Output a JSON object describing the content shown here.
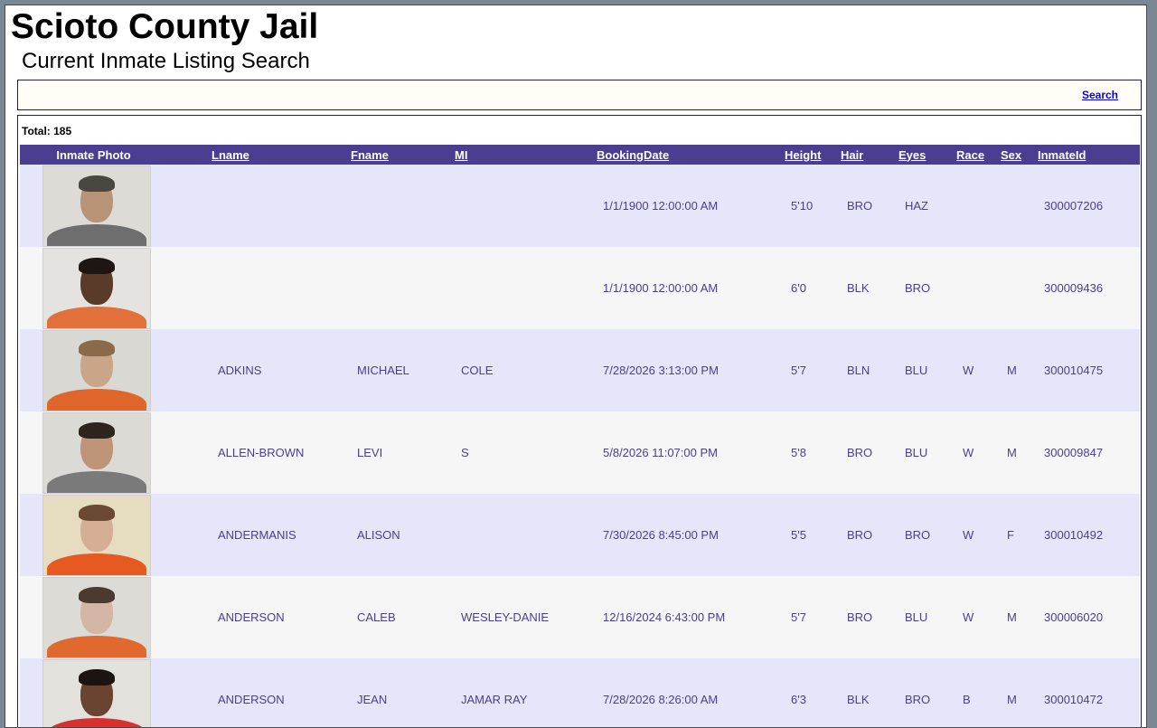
{
  "header": {
    "title": "Scioto County Jail",
    "subtitle": "Current Inmate Listing Search"
  },
  "search": {
    "link_label": "Search"
  },
  "results": {
    "total_label": "Total: 185",
    "columns": {
      "photo": "Inmate Photo",
      "lname": "Lname",
      "fname": "Fname",
      "mi": "MI",
      "booking_date": "BookingDate",
      "height": "Height",
      "hair": "Hair",
      "eyes": "Eyes",
      "race": "Race",
      "sex": "Sex",
      "inmate_id": "InmateId"
    },
    "rows": [
      {
        "lname": "",
        "fname": "",
        "mi": "",
        "booking_date": "1/1/1900 12:00:00 AM",
        "height": "5'10",
        "hair": "BRO",
        "eyes": "HAZ",
        "race": "",
        "sex": "",
        "inmate_id": "300007206",
        "photo": {
          "skin": "#b99377",
          "hair": "#4a4640",
          "shirt": "#6e6e6e",
          "bg": "#dddbd5"
        }
      },
      {
        "lname": "",
        "fname": "",
        "mi": "",
        "booking_date": "1/1/1900 12:00:00 AM",
        "height": "6'0",
        "hair": "BLK",
        "eyes": "BRO",
        "race": "",
        "sex": "",
        "inmate_id": "300009436",
        "photo": {
          "skin": "#5a3a28",
          "hair": "#1e1612",
          "shirt": "#e2703a",
          "bg": "#e4e3df"
        }
      },
      {
        "lname": "ADKINS",
        "fname": "MICHAEL",
        "mi": "COLE",
        "booking_date": "7/28/2026 3:13:00 PM",
        "height": "5'7",
        "hair": "BLN",
        "eyes": "BLU",
        "race": "W",
        "sex": "M",
        "inmate_id": "300010475",
        "photo": {
          "skin": "#c9a58a",
          "hair": "#8a6a48",
          "shirt": "#e0662c",
          "bg": "#d9d8d2"
        }
      },
      {
        "lname": "ALLEN-BROWN",
        "fname": "LEVI",
        "mi": "S",
        "booking_date": "5/8/2026 11:07:00 PM",
        "height": "5'8",
        "hair": "BRO",
        "eyes": "BLU",
        "race": "W",
        "sex": "M",
        "inmate_id": "300009847",
        "photo": {
          "skin": "#c09479",
          "hair": "#2e241e",
          "shirt": "#7a7a7a",
          "bg": "#dcdad4"
        }
      },
      {
        "lname": "ANDERMANIS",
        "fname": "ALISON",
        "mi": "",
        "booking_date": "7/30/2026 8:45:00 PM",
        "height": "5'5",
        "hair": "BRO",
        "eyes": "BRO",
        "race": "W",
        "sex": "F",
        "inmate_id": "300010492",
        "photo": {
          "skin": "#d6ae96",
          "hair": "#6b4a34",
          "shirt": "#e65a22",
          "bg": "#e6dcc0"
        }
      },
      {
        "lname": "ANDERSON",
        "fname": "CALEB",
        "mi": "WESLEY-DANIE",
        "booking_date": "12/16/2024 6:43:00 PM",
        "height": "5'7",
        "hair": "BRO",
        "eyes": "BLU",
        "race": "W",
        "sex": "M",
        "inmate_id": "300006020",
        "photo": {
          "skin": "#d4b6a6",
          "hair": "#4c3a2e",
          "shirt": "#e06a2e",
          "bg": "#dddbd6"
        }
      },
      {
        "lname": "ANDERSON",
        "fname": "JEAN",
        "mi": "JAMAR RAY",
        "booking_date": "7/28/2026 8:26:00 AM",
        "height": "6'3",
        "hair": "BLK",
        "eyes": "BRO",
        "race": "B",
        "sex": "M",
        "inmate_id": "300010472",
        "photo": {
          "skin": "#6a4430",
          "hair": "#1c1410",
          "shirt": "#d9302e",
          "bg": "#e2e1dc"
        }
      }
    ]
  }
}
